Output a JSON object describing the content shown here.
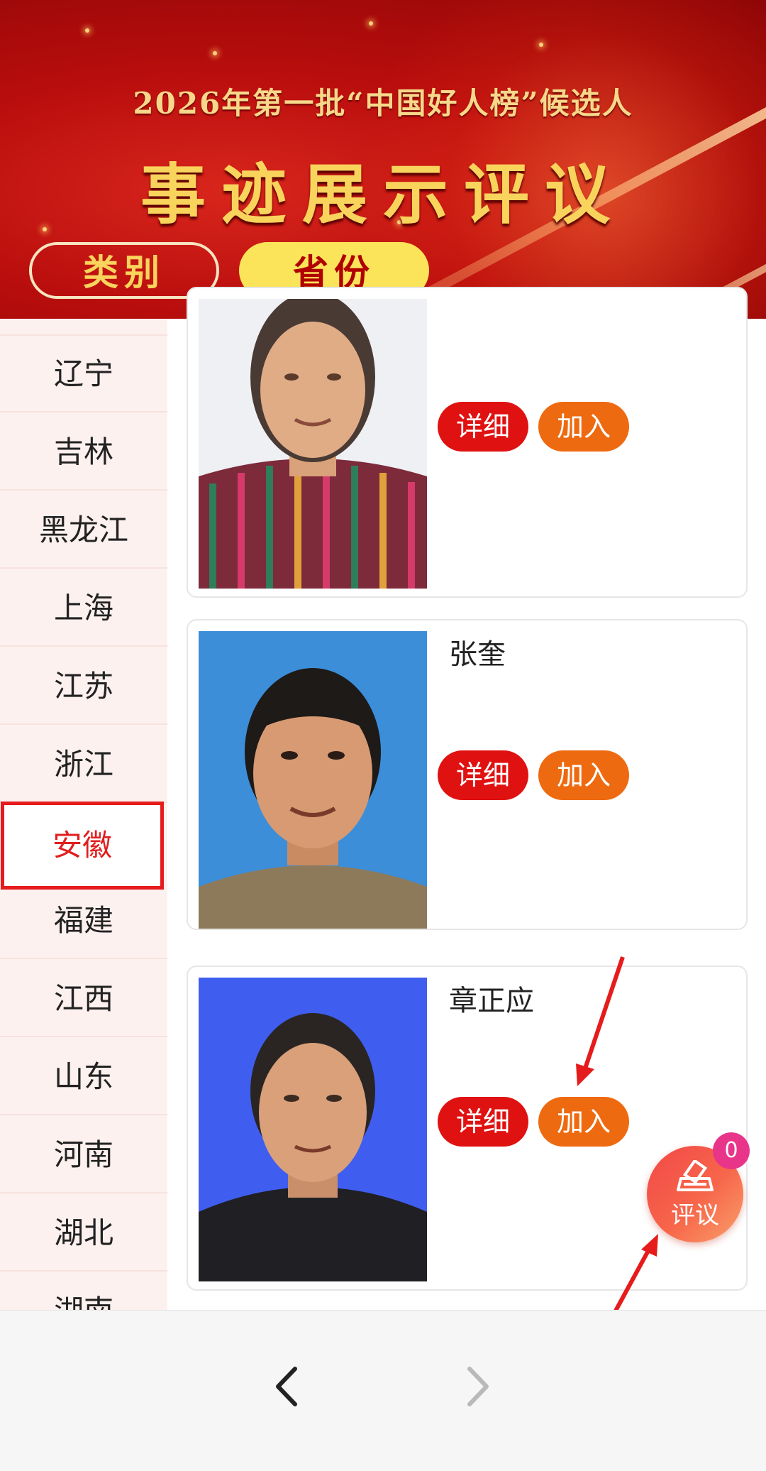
{
  "banner": {
    "subtitle": "2026年第一批“中国好人榜”候选人",
    "title": "事迹展示评议",
    "tabs": {
      "category": "类别",
      "province": "省份"
    }
  },
  "sidebar": {
    "items": [
      "辽宁",
      "吉林",
      "黑龙江",
      "上海",
      "江苏",
      "浙江",
      "安徽",
      "福建",
      "江西",
      "山东",
      "河南",
      "湖北",
      "湖南"
    ],
    "active": "安徽"
  },
  "cards": [
    {
      "name": "",
      "detail_label": "详细",
      "join_label": "加入"
    },
    {
      "name": "张奎",
      "detail_label": "详细",
      "join_label": "加入"
    },
    {
      "name": "章正应",
      "detail_label": "详细",
      "join_label": "加入"
    }
  ],
  "float_button": {
    "label": "评议",
    "badge": "0"
  },
  "icons": {
    "back": "chevron-left-icon",
    "forward": "chevron-right-icon",
    "review": "ballot-box-icon"
  },
  "colors": {
    "brand_red": "#e01111",
    "join_orange": "#ee6a10",
    "header_gold": "#f9d45c",
    "annotation_arrow": "#e61b1b"
  }
}
